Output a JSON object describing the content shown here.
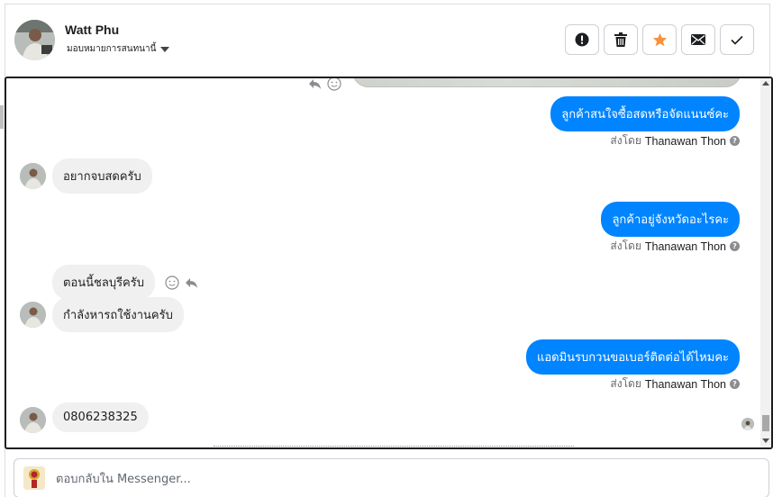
{
  "header": {
    "name": "Watt Phu",
    "assign_label": "มอบหมายการสนทนานี้"
  },
  "actions": [
    {
      "name": "spam-button",
      "icon": "exclamation-icon"
    },
    {
      "name": "delete-button",
      "icon": "trash-icon"
    },
    {
      "name": "star-button",
      "icon": "star-icon",
      "color": "#f7923b"
    },
    {
      "name": "mark-unread-button",
      "icon": "envelope-icon"
    },
    {
      "name": "mark-done-button",
      "icon": "checkmark-icon"
    }
  ],
  "messages": {
    "m1": {
      "text": "ลูกค้าสนใจซื้อสดหรือจัดแนนซ์คะ",
      "sender_prefix": "ส่งโดย",
      "sender": "Thanawan Thon"
    },
    "m2": {
      "text": "อยากจบสดครับ"
    },
    "m3": {
      "text": "ลูกค้าอยู่จังหวัดอะไรคะ",
      "sender_prefix": "ส่งโดย",
      "sender": "Thanawan Thon"
    },
    "m4": {
      "text": "ตอนนี้ชลบุรีครับ"
    },
    "m5": {
      "text": "กำลังหารถใช้งานครับ"
    },
    "m6": {
      "text": "แอดมินรบกวนขอเบอร์ติดต่อได้ไหมคะ",
      "sender_prefix": "ส่งโดย",
      "sender": "Thanawan Thon"
    },
    "m7": {
      "text": "0806238325"
    }
  },
  "reply": {
    "placeholder": "ตอบกลับใน Messenger..."
  },
  "colors": {
    "outgoing_bubble": "#0084ff",
    "incoming_bubble": "#f0f0f0",
    "star": "#f7923b"
  }
}
